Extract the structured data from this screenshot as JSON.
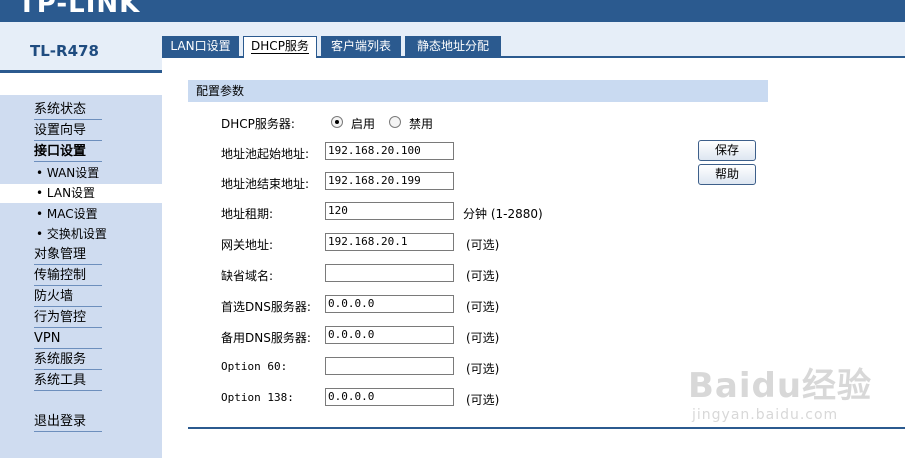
{
  "header": {
    "logo": "TP-LINK"
  },
  "sidebar": {
    "model": "TL-R478",
    "items": [
      {
        "label": "系统状态"
      },
      {
        "label": "设置向导"
      },
      {
        "label": "接口设置"
      },
      {
        "label": "• WAN设置"
      },
      {
        "label": "• LAN设置"
      },
      {
        "label": "• MAC设置"
      },
      {
        "label": "• 交换机设置"
      },
      {
        "label": "对象管理"
      },
      {
        "label": "传输控制"
      },
      {
        "label": "防火墙"
      },
      {
        "label": "行为管控"
      },
      {
        "label": "VPN"
      },
      {
        "label": "系统服务"
      },
      {
        "label": "系统工具"
      },
      {
        "label": "退出登录"
      }
    ]
  },
  "tabs": [
    {
      "label": "LAN口设置"
    },
    {
      "label": "DHCP服务"
    },
    {
      "label": "客户端列表"
    },
    {
      "label": "静态地址分配"
    }
  ],
  "section": {
    "title": "配置参数"
  },
  "form": {
    "dhcp_label": "DHCP服务器:",
    "radio_enable": "启用",
    "radio_disable": "禁用",
    "dhcp_selected": "启用",
    "start_label": "地址池起始地址:",
    "start_value": "192.168.20.100",
    "end_label": "地址池结束地址:",
    "end_value": "192.168.20.199",
    "lease_label": "地址租期:",
    "lease_value": "120",
    "lease_unit": "分钟 (1-2880)",
    "gateway_label": "网关地址:",
    "gateway_value": "192.168.20.1",
    "domain_label": "缺省域名:",
    "domain_value": "",
    "dns1_label": "首选DNS服务器:",
    "dns1_value": "0.0.0.0",
    "dns2_label": "备用DNS服务器:",
    "dns2_value": "0.0.0.0",
    "opt60_label": "Option 60:",
    "opt60_value": "",
    "opt138_label": "Option 138:",
    "opt138_value": "0.0.0.0",
    "optional": "(可选)"
  },
  "buttons": {
    "save": "保存",
    "help": "帮助"
  },
  "watermark": {
    "main": "Baidu经验",
    "sub": "jingyan.baidu.com"
  }
}
